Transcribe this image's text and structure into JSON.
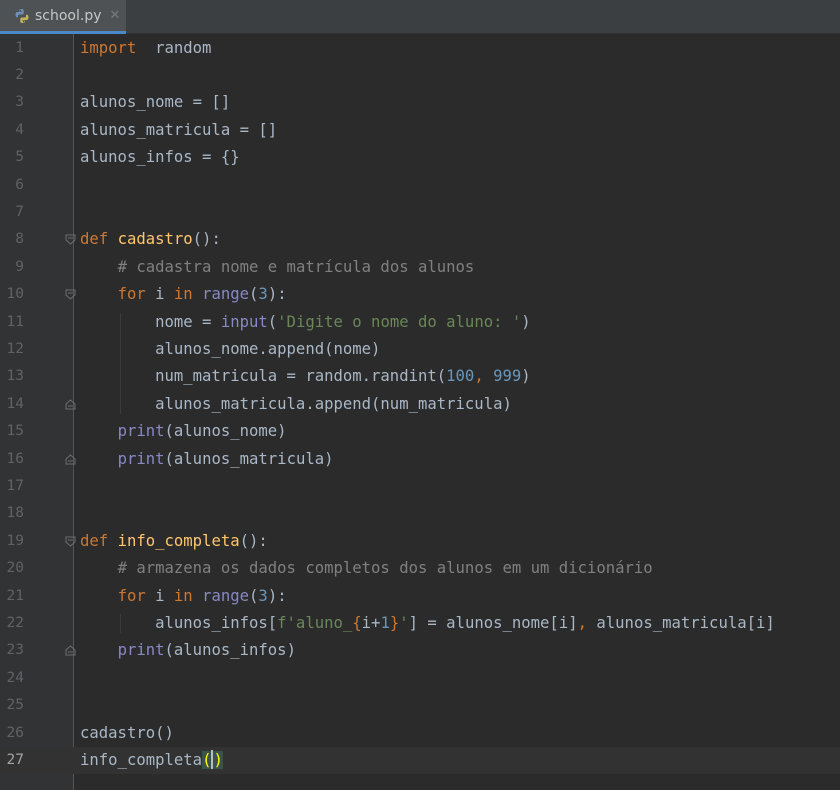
{
  "tab": {
    "filename": "school.py",
    "close_glyph": "✕",
    "icon": "python-file-icon"
  },
  "editor": {
    "current_line": 27,
    "lines": [
      {
        "n": "1",
        "tokens": [
          [
            "kw",
            "import"
          ],
          [
            "",
            "  random"
          ]
        ]
      },
      {
        "n": "2",
        "tokens": []
      },
      {
        "n": "3",
        "tokens": [
          [
            "",
            "alunos_nome = []"
          ]
        ]
      },
      {
        "n": "4",
        "tokens": [
          [
            "",
            "alunos_matricula = []"
          ]
        ]
      },
      {
        "n": "5",
        "tokens": [
          [
            "",
            "alunos_infos = {}"
          ]
        ]
      },
      {
        "n": "6",
        "tokens": []
      },
      {
        "n": "7",
        "tokens": []
      },
      {
        "n": "8",
        "fold": "open",
        "tokens": [
          [
            "kw",
            "def "
          ],
          [
            "fn",
            "cadastro"
          ],
          [
            "",
            "():"
          ]
        ]
      },
      {
        "n": "9",
        "tokens": [
          [
            "",
            "    "
          ],
          [
            "cmt",
            "# cadastra nome e matrícula dos alunos"
          ]
        ]
      },
      {
        "n": "10",
        "fold": "open",
        "tokens": [
          [
            "",
            "    "
          ],
          [
            "kw",
            "for"
          ],
          [
            "",
            " i "
          ],
          [
            "kw",
            "in"
          ],
          [
            "",
            " "
          ],
          [
            "bi",
            "range"
          ],
          [
            "",
            "("
          ],
          [
            "num",
            "3"
          ],
          [
            "",
            "):"
          ]
        ]
      },
      {
        "n": "11",
        "tokens": [
          [
            "",
            "        nome = "
          ],
          [
            "bi",
            "input"
          ],
          [
            "",
            "("
          ],
          [
            "str",
            "'Digite o nome do aluno: '"
          ],
          [
            "",
            ")"
          ]
        ]
      },
      {
        "n": "12",
        "tokens": [
          [
            "",
            "        alunos_nome.append(nome)"
          ]
        ]
      },
      {
        "n": "13",
        "tokens": [
          [
            "",
            "        num_matricula = random.randint("
          ],
          [
            "num",
            "100"
          ],
          [
            "kw",
            ", "
          ],
          [
            "num",
            "999"
          ],
          [
            "",
            ")"
          ]
        ]
      },
      {
        "n": "14",
        "fold": "close",
        "tokens": [
          [
            "",
            "        alunos_matricula.append(num_matricula)"
          ]
        ]
      },
      {
        "n": "15",
        "tokens": [
          [
            "",
            "    "
          ],
          [
            "bi",
            "print"
          ],
          [
            "",
            "(alunos_nome)"
          ]
        ]
      },
      {
        "n": "16",
        "fold": "close",
        "tokens": [
          [
            "",
            "    "
          ],
          [
            "bi",
            "print"
          ],
          [
            "",
            "(alunos_matricula)"
          ]
        ]
      },
      {
        "n": "17",
        "tokens": []
      },
      {
        "n": "18",
        "tokens": []
      },
      {
        "n": "19",
        "fold": "open",
        "tokens": [
          [
            "kw",
            "def "
          ],
          [
            "fn",
            "info_completa"
          ],
          [
            "",
            "():"
          ]
        ]
      },
      {
        "n": "20",
        "tokens": [
          [
            "",
            "    "
          ],
          [
            "cmt",
            "# armazena os dados completos dos alunos em um dicionário"
          ]
        ]
      },
      {
        "n": "21",
        "tokens": [
          [
            "",
            "    "
          ],
          [
            "kw",
            "for"
          ],
          [
            "",
            " i "
          ],
          [
            "kw",
            "in"
          ],
          [
            "",
            " "
          ],
          [
            "bi",
            "range"
          ],
          [
            "",
            "("
          ],
          [
            "num",
            "3"
          ],
          [
            "",
            "):"
          ]
        ]
      },
      {
        "n": "22",
        "tokens": [
          [
            "",
            "        alunos_infos["
          ],
          [
            "str",
            "f'aluno_"
          ],
          [
            "kw",
            "{"
          ],
          [
            "",
            "i+"
          ],
          [
            "num",
            "1"
          ],
          [
            "kw",
            "}"
          ],
          [
            "str",
            "'"
          ],
          [
            "",
            "] = alunos_nome[i]"
          ],
          [
            "kw",
            ", "
          ],
          [
            "",
            "alunos_matricula[i]"
          ]
        ]
      },
      {
        "n": "23",
        "fold": "close",
        "tokens": [
          [
            "",
            "    "
          ],
          [
            "bi",
            "print"
          ],
          [
            "",
            "(alunos_infos)"
          ]
        ]
      },
      {
        "n": "24",
        "tokens": []
      },
      {
        "n": "25",
        "tokens": []
      },
      {
        "n": "26",
        "tokens": [
          [
            "",
            "cadastro()"
          ]
        ]
      },
      {
        "n": "27",
        "tokens": [
          [
            "",
            "info_completa"
          ],
          [
            "pb",
            "("
          ],
          [
            "caret",
            ""
          ],
          [
            "pb",
            ")"
          ]
        ]
      }
    ]
  }
}
